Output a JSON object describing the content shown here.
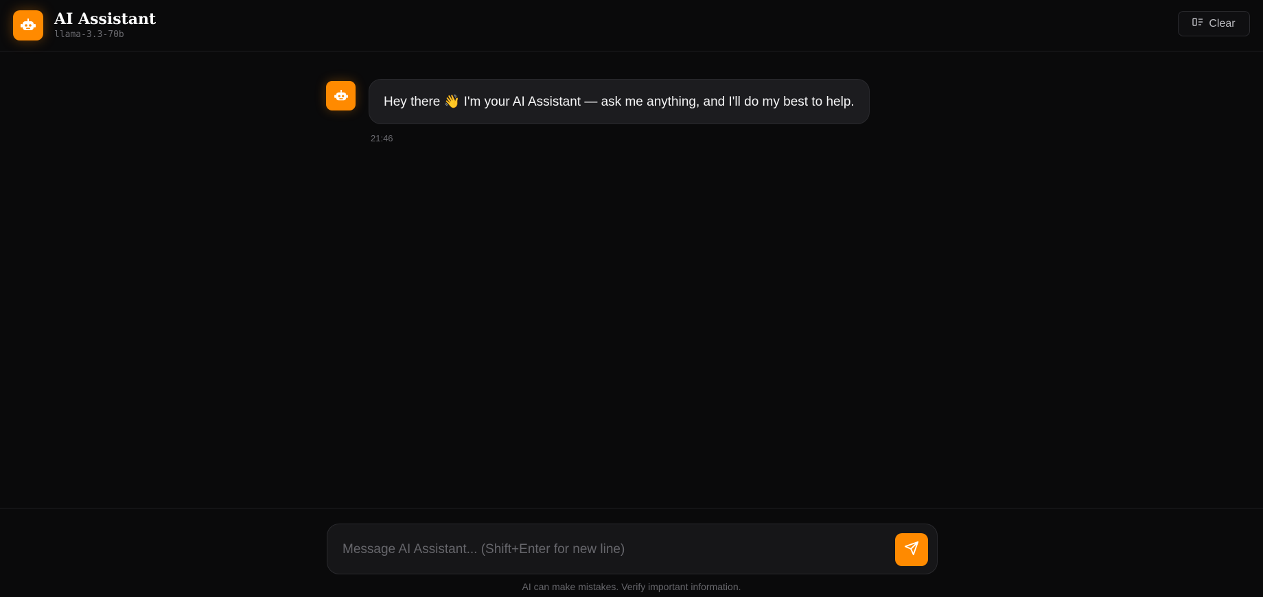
{
  "header": {
    "title": "AI Assistant",
    "model": "llama-3.3-70b",
    "clear_label": "Clear"
  },
  "messages": [
    {
      "role": "assistant",
      "text": "Hey there 👋 I'm your AI Assistant — ask me anything, and I'll do my best to help.",
      "time": "21:46"
    }
  ],
  "composer": {
    "placeholder": "Message AI Assistant... (Shift+Enter for new line)",
    "value": ""
  },
  "footer": {
    "disclaimer": "AI can make mistakes. Verify important information."
  },
  "icons": {
    "logo": "robot-icon",
    "clear": "sidebar-clear-icon",
    "send": "send-icon"
  },
  "colors": {
    "accent": "#ff8a00",
    "background": "#0a0a0b",
    "bubble": "#1c1c1f"
  }
}
